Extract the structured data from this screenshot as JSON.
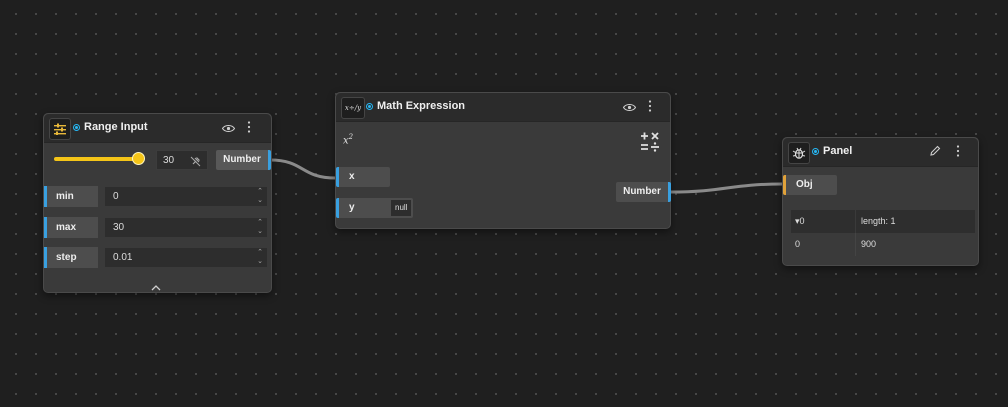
{
  "range_input": {
    "title": "Range Input",
    "slider_value": "30",
    "slider_fraction": 1.0,
    "output_label": "Number",
    "params": [
      {
        "label": "min",
        "value": "0"
      },
      {
        "label": "max",
        "value": "30"
      },
      {
        "label": "step",
        "value": "0.01"
      }
    ]
  },
  "math_expression": {
    "title": "Math Expression",
    "expression": "x",
    "expression_sup": "2",
    "icon_text": "x÷/y",
    "inputs": [
      {
        "label": "x",
        "badge": ""
      },
      {
        "label": "y",
        "badge": "null"
      }
    ],
    "output_label": "Number"
  },
  "panel": {
    "title": "Panel",
    "input_label": "Obj",
    "table": {
      "head_index": "▾0",
      "head_info": "length: 1",
      "rows": [
        {
          "index": "0",
          "value": "900"
        }
      ]
    }
  },
  "colors": {
    "accent": "#27b8f5",
    "port_blue": "#39a0e0",
    "port_orange": "#e0a23a",
    "slider": "#f5c518"
  }
}
